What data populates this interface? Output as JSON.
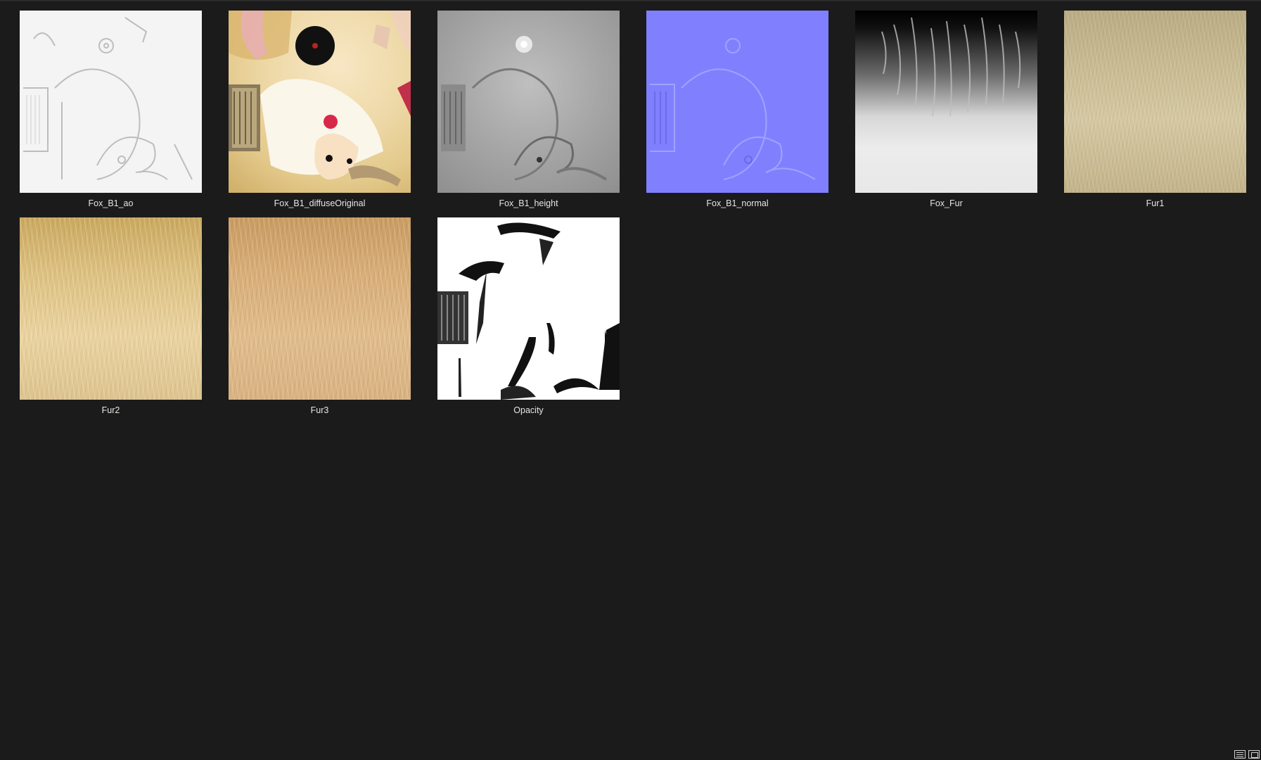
{
  "items": [
    {
      "name": "Fox_B1_ao"
    },
    {
      "name": "Fox_B1_diffuseOriginal"
    },
    {
      "name": "Fox_B1_height"
    },
    {
      "name": "Fox_B1_normal"
    },
    {
      "name": "Fox_Fur"
    },
    {
      "name": "Fur1"
    },
    {
      "name": "Fur2"
    },
    {
      "name": "Fur3"
    },
    {
      "name": "Opacity"
    }
  ],
  "view_modes": {
    "list": "list-view-icon",
    "thumbnail": "thumbnail-view-icon"
  },
  "colors": {
    "background": "#1b1b1c",
    "label": "#e6e6e6"
  }
}
